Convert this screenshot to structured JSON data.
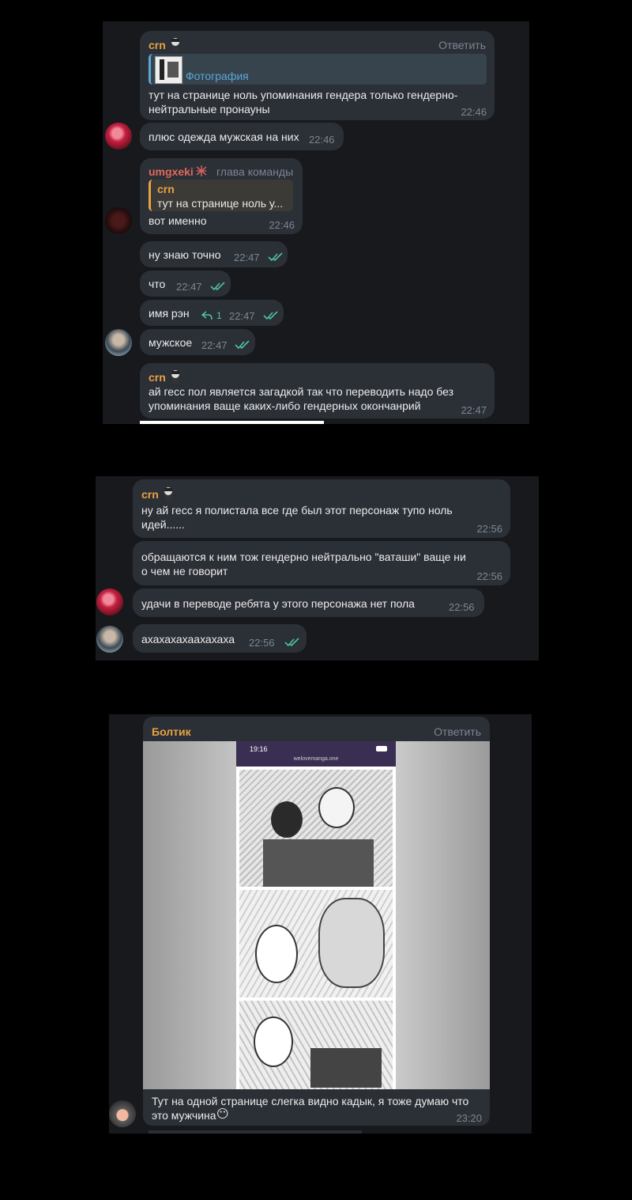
{
  "colors": {
    "panel_bg": "#18191d",
    "bubble_bg": "#2b2f36",
    "name_orange": "#e8a243",
    "name_red": "#e06a5a",
    "reply_blue": "#5aa8d8",
    "check_teal": "#4fc3a1",
    "time_gray": "#7d8692"
  },
  "screenshot1": {
    "messages": [
      {
        "sender": "crn",
        "reply_action": "Ответить",
        "quote_label": "Фотография",
        "text_line1": "тут на странице ноль упоминания гендера только гендерно-",
        "text_line2": "нейтральные пронауны",
        "time": "22:46"
      },
      {
        "text": "плюс одежда мужская на них",
        "time": "22:46"
      },
      {
        "sender": "umgxeki",
        "role": "глава команды",
        "quote_author": "crn",
        "quote_text": "тут на странице ноль у...",
        "text": "вот именно",
        "time": "22:46"
      },
      {
        "text": "ну знаю точно",
        "time": "22:47"
      },
      {
        "text": "что",
        "time": "22:47"
      },
      {
        "text": "имя рэн",
        "reply_count": "1",
        "time": "22:47"
      },
      {
        "text": "мужское",
        "time": "22:47"
      },
      {
        "sender": "crn",
        "text_line1": "ай гесс пол является загадкой так что переводить надо без",
        "text_line2": "упоминания ваще каких-либо гендерных окончанрий",
        "time": "22:47"
      }
    ]
  },
  "screenshot2": {
    "messages": [
      {
        "sender": "crn",
        "text_line1": "ну ай гесс я полистала все где был этот персонаж тупо ноль",
        "text_line2": "идей......",
        "time": "22:56"
      },
      {
        "text_line1": "обращаются к ним тож гендерно нейтрально \"ваташи\" ваще ни",
        "text_line2": "о чем не говорит",
        "time": "22:56"
      },
      {
        "text": "удачи в переводе ребята у этого персонажа нет пола",
        "time": "22:56"
      },
      {
        "text": "ахахахахаахахаха",
        "time": "22:56"
      }
    ]
  },
  "screenshot3": {
    "sender": "Болтик",
    "reply_action": "Ответить",
    "phone_time": "19:16",
    "phone_url": "welovemanga.one",
    "text_line1": "Тут на одной странице слегка видно кадык, я тоже думаю что",
    "text_line2": "это мужчина",
    "emoji": "😶",
    "time": "23:20"
  }
}
